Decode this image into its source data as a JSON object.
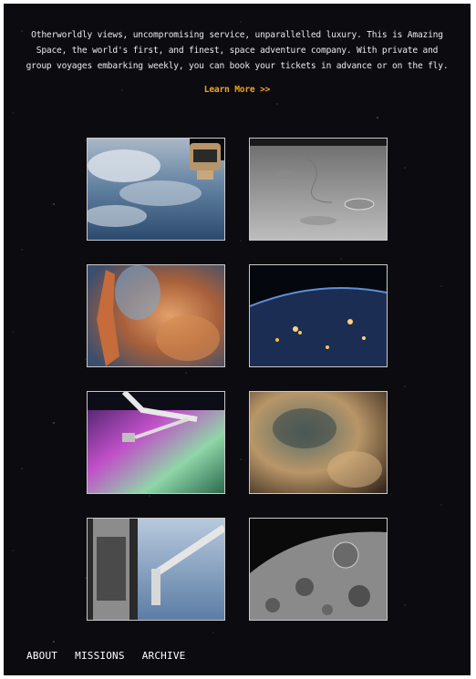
{
  "intro": {
    "text": "Otherworldly views, uncompromising service, unparallelled luxury. This is Amazing Space, the world's first, and finest, space adventure company. With private and group voyages embarking weekly, you can book your tickets in advance or on the fly.",
    "learn_more": "Learn More >>"
  },
  "colors": {
    "background": "#0b0b10",
    "accent": "#f5a21b",
    "text": "#e9e9ee"
  },
  "gallery": {
    "images": [
      {
        "name": "earth-from-station-image"
      },
      {
        "name": "lunar-surface-image"
      },
      {
        "name": "nebula-pillar-image"
      },
      {
        "name": "earth-city-lights-image"
      },
      {
        "name": "aurora-robotic-arm-image"
      },
      {
        "name": "nebula-clouds-image"
      },
      {
        "name": "hubble-telescope-image"
      },
      {
        "name": "moon-craters-image"
      }
    ]
  },
  "nav": {
    "items": [
      "ABOUT",
      "MISSIONS",
      "ARCHIVE"
    ]
  }
}
